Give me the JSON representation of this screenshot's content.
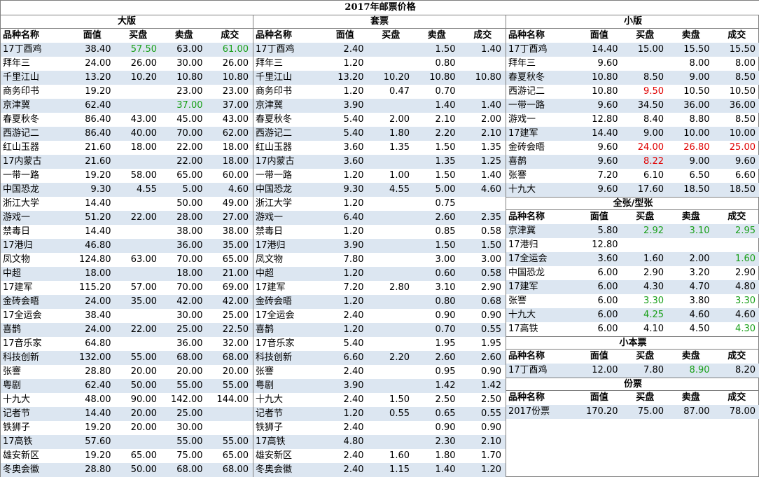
{
  "title": "2017年邮票价格",
  "headers": [
    "品种名称",
    "面值",
    "买盘",
    "卖盘",
    "成交"
  ],
  "colors": {
    "green": "#1aa01a",
    "red": "#e00000",
    "row_alt": "#dce6f1"
  },
  "sections": {
    "large": {
      "title": "大版",
      "rows": [
        [
          "17丁酉鸡",
          "38.40",
          "57.50",
          "63.00",
          "61.00"
        ],
        [
          "拜年三",
          "24.00",
          "26.00",
          "30.00",
          "26.00"
        ],
        [
          "千里江山",
          "13.20",
          "10.20",
          "10.80",
          "10.80"
        ],
        [
          "商务印书",
          "19.20",
          "",
          "23.00",
          "23.00"
        ],
        [
          "京津冀",
          "62.40",
          "",
          "37.00",
          "37.00"
        ],
        [
          "春夏秋冬",
          "86.40",
          "43.00",
          "45.00",
          "43.00"
        ],
        [
          "西游记二",
          "86.40",
          "40.00",
          "70.00",
          "62.00"
        ],
        [
          "红山玉器",
          "21.60",
          "18.00",
          "22.00",
          "18.00"
        ],
        [
          "17内蒙古",
          "21.60",
          "",
          "22.00",
          "18.00"
        ],
        [
          "一带一路",
          "19.20",
          "58.00",
          "65.00",
          "60.00"
        ],
        [
          "中国恐龙",
          "9.30",
          "4.55",
          "5.00",
          "4.60"
        ],
        [
          "浙江大学",
          "14.40",
          "",
          "50.00",
          "49.00"
        ],
        [
          "游戏一",
          "51.20",
          "22.00",
          "28.00",
          "27.00"
        ],
        [
          "禁毒日",
          "14.40",
          "",
          "38.00",
          "38.00"
        ],
        [
          "17港归",
          "46.80",
          "",
          "36.00",
          "35.00"
        ],
        [
          "凤文物",
          "124.80",
          "63.00",
          "70.00",
          "65.00"
        ],
        [
          "中超",
          "18.00",
          "",
          "18.00",
          "21.00"
        ],
        [
          "17建军",
          "115.20",
          "57.00",
          "70.00",
          "69.00"
        ],
        [
          "金砖会晤",
          "24.00",
          "35.00",
          "42.00",
          "42.00"
        ],
        [
          "17全运会",
          "38.40",
          "",
          "30.00",
          "25.00"
        ],
        [
          "喜鹊",
          "24.00",
          "22.00",
          "25.00",
          "22.50"
        ],
        [
          "17音乐家",
          "64.80",
          "",
          "36.00",
          "32.00"
        ],
        [
          "科技创新",
          "132.00",
          "55.00",
          "68.00",
          "68.00"
        ],
        [
          "张謇",
          "28.80",
          "20.00",
          "20.00",
          "20.00"
        ],
        [
          "粤剧",
          "62.40",
          "50.00",
          "55.00",
          "55.00"
        ],
        [
          "十九大",
          "48.00",
          "90.00",
          "142.00",
          "144.00"
        ],
        [
          "记者节",
          "14.40",
          "20.00",
          "25.00",
          ""
        ],
        [
          "铁狮子",
          "19.20",
          "20.00",
          "30.00",
          ""
        ],
        [
          "17高铁",
          "57.60",
          "",
          "55.00",
          "55.00"
        ],
        [
          "雄安新区",
          "19.20",
          "65.00",
          "75.00",
          "65.00"
        ],
        [
          "冬奥会徽",
          "28.80",
          "50.00",
          "68.00",
          "68.00"
        ]
      ]
    },
    "set": {
      "title": "套票",
      "rows": [
        [
          "17丁酉鸡",
          "2.40",
          "",
          "1.50",
          "1.40"
        ],
        [
          "拜年三",
          "1.20",
          "",
          "0.80",
          ""
        ],
        [
          "千里江山",
          "13.20",
          "10.20",
          "10.80",
          "10.80"
        ],
        [
          "商务印书",
          "1.20",
          "0.47",
          "0.70",
          ""
        ],
        [
          "京津冀",
          "3.90",
          "",
          "1.40",
          "1.40"
        ],
        [
          "春夏秋冬",
          "5.40",
          "2.00",
          "2.10",
          "2.00"
        ],
        [
          "西游记二",
          "5.40",
          "1.80",
          "2.20",
          "2.10"
        ],
        [
          "红山玉器",
          "3.60",
          "1.35",
          "1.50",
          "1.35"
        ],
        [
          "17内蒙古",
          "3.60",
          "",
          "1.35",
          "1.25"
        ],
        [
          "一带一路",
          "1.20",
          "1.00",
          "1.50",
          "1.40"
        ],
        [
          "中国恐龙",
          "9.30",
          "4.55",
          "5.00",
          "4.60"
        ],
        [
          "浙江大学",
          "1.20",
          "",
          "0.75",
          ""
        ],
        [
          "游戏一",
          "6.40",
          "",
          "2.60",
          "2.35"
        ],
        [
          "禁毒日",
          "1.20",
          "",
          "0.85",
          "0.58"
        ],
        [
          "17港归",
          "3.90",
          "",
          "1.50",
          "1.50"
        ],
        [
          "凤文物",
          "7.80",
          "",
          "3.00",
          "3.00"
        ],
        [
          "中超",
          "1.20",
          "",
          "0.60",
          "0.58"
        ],
        [
          "17建军",
          "7.20",
          "2.80",
          "3.10",
          "2.90"
        ],
        [
          "金砖会晤",
          "1.20",
          "",
          "0.80",
          "0.68"
        ],
        [
          "17全运会",
          "2.40",
          "",
          "0.90",
          "0.90"
        ],
        [
          "喜鹊",
          "1.20",
          "",
          "0.70",
          "0.55"
        ],
        [
          "17音乐家",
          "5.40",
          "",
          "1.95",
          "1.95"
        ],
        [
          "科技创新",
          "6.60",
          "2.20",
          "2.60",
          "2.60"
        ],
        [
          "张謇",
          "2.40",
          "",
          "0.95",
          "0.90"
        ],
        [
          "粤剧",
          "3.90",
          "",
          "1.42",
          "1.42"
        ],
        [
          "十九大",
          "2.40",
          "1.50",
          "2.50",
          "2.50"
        ],
        [
          "记者节",
          "1.20",
          "0.55",
          "0.65",
          "0.55"
        ],
        [
          "铁狮子",
          "2.40",
          "",
          "0.90",
          "0.90"
        ],
        [
          "17高铁",
          "4.80",
          "",
          "2.30",
          "2.10"
        ],
        [
          "雄安新区",
          "2.40",
          "1.60",
          "1.80",
          "1.70"
        ],
        [
          "冬奥会徽",
          "2.40",
          "1.15",
          "1.40",
          "1.20"
        ]
      ]
    },
    "small": {
      "title": "小版",
      "rows": [
        [
          "17丁酉鸡",
          "14.40",
          "15.00",
          "15.50",
          "15.50"
        ],
        [
          "拜年三",
          "9.60",
          "",
          "8.00",
          "8.00"
        ],
        [
          "春夏秋冬",
          "10.80",
          "8.50",
          "9.00",
          "8.50"
        ],
        [
          "西游记二",
          "10.80",
          "9.50",
          "10.50",
          "10.50"
        ],
        [
          "一带一路",
          "9.60",
          "34.50",
          "36.00",
          "36.00"
        ],
        [
          "游戏一",
          "12.80",
          "8.40",
          "8.80",
          "8.50"
        ],
        [
          "17建军",
          "14.40",
          "9.00",
          "10.00",
          "10.00"
        ],
        [
          "金砖会晤",
          "9.60",
          "24.00",
          "26.80",
          "25.00"
        ],
        [
          "喜鹊",
          "9.60",
          "8.22",
          "9.00",
          "9.60"
        ],
        [
          "张謇",
          "7.20",
          "6.10",
          "6.50",
          "6.60"
        ],
        [
          "十九大",
          "9.60",
          "17.60",
          "18.50",
          "18.50"
        ]
      ]
    },
    "single": {
      "title": "全张/型张",
      "rows": [
        [
          "京津冀",
          "5.80",
          "2.92",
          "3.10",
          "2.95"
        ],
        [
          "17港归",
          "12.80",
          "",
          "",
          ""
        ],
        [
          "17全运会",
          "3.60",
          "1.60",
          "2.00",
          "1.60"
        ],
        [
          "中国恐龙",
          "6.00",
          "2.90",
          "3.20",
          "2.90"
        ],
        [
          "17建军",
          "6.00",
          "4.30",
          "4.70",
          "4.80"
        ],
        [
          "张謇",
          "6.00",
          "3.30",
          "3.80",
          "3.30"
        ],
        [
          "十九大",
          "6.00",
          "4.25",
          "4.60",
          "4.60"
        ],
        [
          "17高铁",
          "6.00",
          "4.10",
          "4.50",
          "4.30"
        ]
      ]
    },
    "booklet": {
      "title": "小本票",
      "rows": [
        [
          "17丁酉鸡",
          "12.00",
          "7.80",
          "8.90",
          "8.20"
        ]
      ]
    },
    "annual": {
      "title": "份票",
      "rows": [
        [
          "2017份票",
          "170.20",
          "75.00",
          "87.00",
          "78.00"
        ]
      ]
    }
  },
  "highlights": {
    "large": [
      [
        0,
        2,
        "g"
      ],
      [
        0,
        4,
        "g"
      ],
      [
        4,
        3,
        "g"
      ]
    ],
    "small": [
      [
        3,
        2,
        "r"
      ],
      [
        7,
        2,
        "r"
      ],
      [
        7,
        3,
        "r"
      ],
      [
        7,
        4,
        "r"
      ],
      [
        8,
        2,
        "r"
      ]
    ],
    "single": [
      [
        0,
        2,
        "g"
      ],
      [
        0,
        3,
        "g"
      ],
      [
        0,
        4,
        "g"
      ],
      [
        2,
        4,
        "g"
      ],
      [
        5,
        2,
        "g"
      ],
      [
        5,
        4,
        "g"
      ],
      [
        6,
        2,
        "g"
      ],
      [
        7,
        4,
        "g"
      ]
    ],
    "booklet": [
      [
        0,
        3,
        "g"
      ]
    ]
  }
}
